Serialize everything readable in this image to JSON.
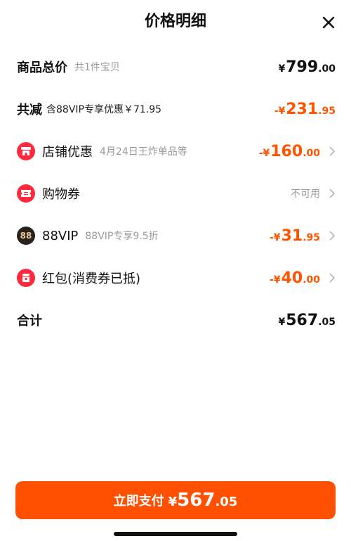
{
  "header": {
    "title": "价格明细"
  },
  "rows": {
    "total": {
      "label": "商品总价",
      "sub": "共1件宝贝",
      "yen": "¥",
      "int": "799",
      "dec": ".00"
    },
    "reduce": {
      "label": "共减",
      "sub": "含88VIP专享优惠￥71.95",
      "prefix": "-¥",
      "int": "231",
      "dec": ".95"
    },
    "store": {
      "label": "店铺优惠",
      "sub": "4月24日王炸单品等",
      "prefix": "-¥",
      "int": "160",
      "dec": ".00"
    },
    "coupon": {
      "label": "购物券",
      "status": "不可用"
    },
    "vip": {
      "label": "88VIP",
      "badge": "88",
      "sub": "88VIP专享9.5折",
      "prefix": "-¥",
      "int": "31",
      "dec": ".95"
    },
    "redpack": {
      "label": "红包(消费券已抵)",
      "prefix": "-¥",
      "int": "40",
      "dec": ".00"
    },
    "sum": {
      "label": "合计",
      "yen": "¥",
      "int": "567",
      "dec": ".05"
    }
  },
  "pay": {
    "label": "立即支付",
    "yen": "¥",
    "int": "567",
    "dec": ".05"
  },
  "colors": {
    "accent": "#ff5500",
    "button": "#ff4f00",
    "icon_red": "#ff2a3d",
    "icon_dark": "#2a221d"
  }
}
